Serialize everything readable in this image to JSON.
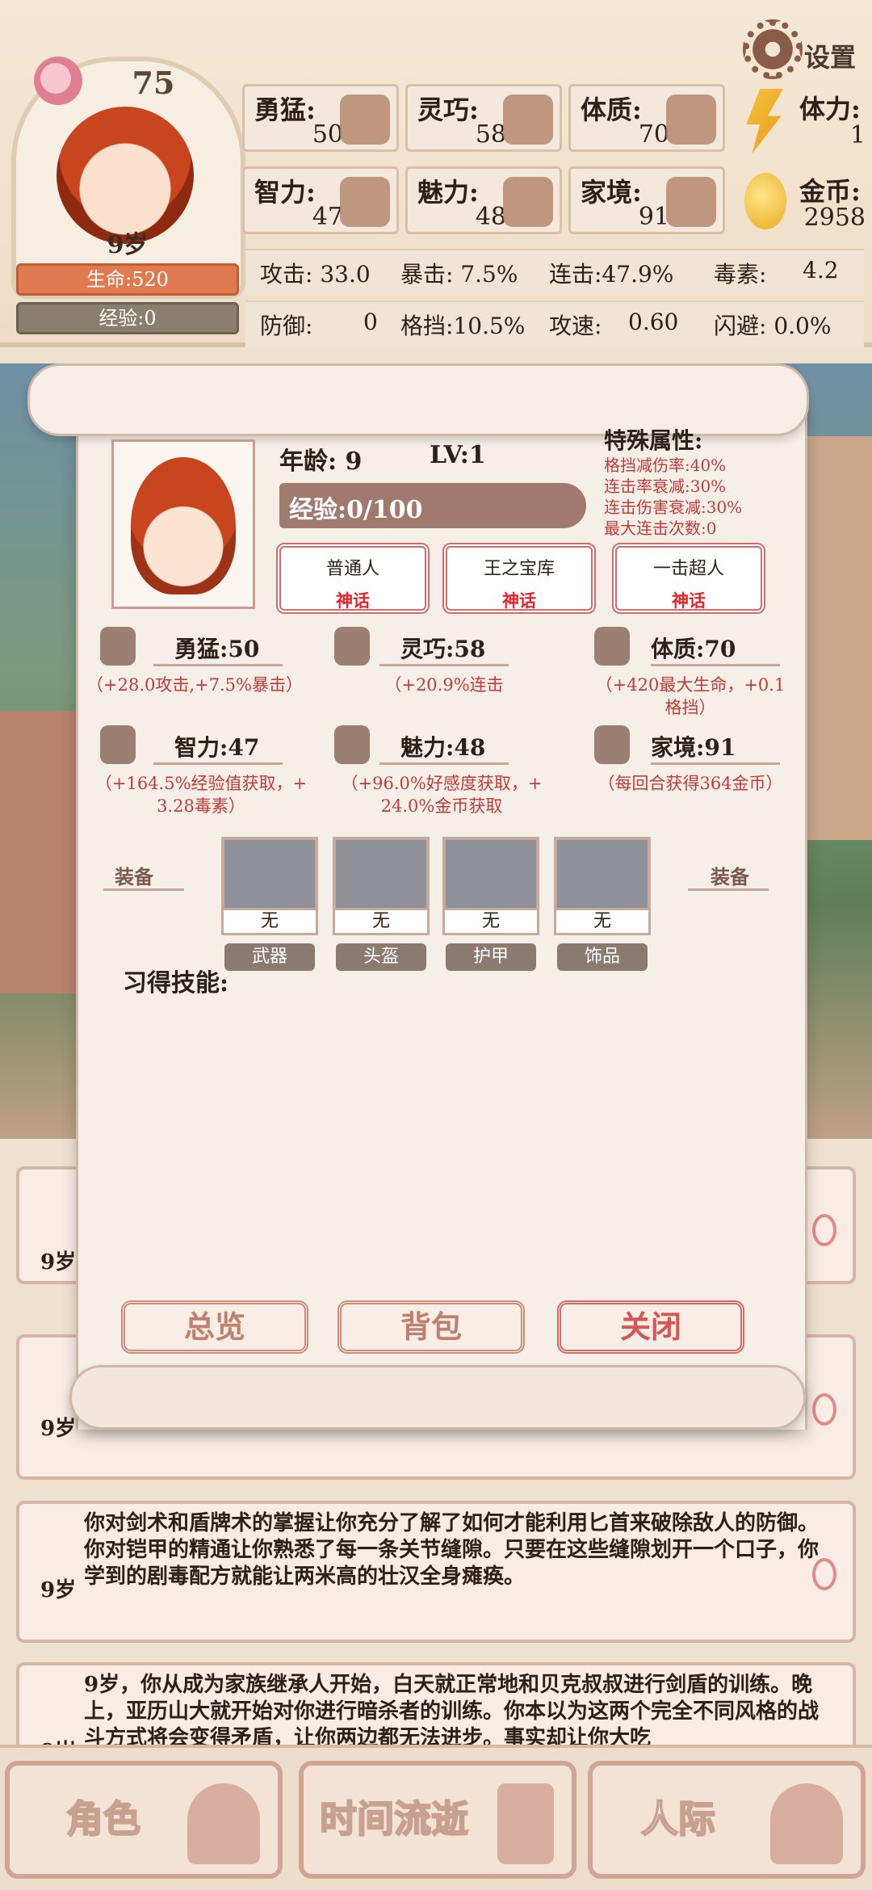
{
  "header": {
    "level": "75",
    "age_badge": "9岁",
    "hp_label": "生命:520",
    "exp_label": "经验:0",
    "settings_label": "设置",
    "stats": [
      {
        "label": "勇猛:",
        "value": "50",
        "icon": "fist-icon"
      },
      {
        "label": "灵巧:",
        "value": "58",
        "icon": "cloak-icon"
      },
      {
        "label": "体质:",
        "value": "70",
        "icon": "arm-muscle-icon"
      },
      {
        "label": "智力:",
        "value": "47",
        "icon": "brain-icon"
      },
      {
        "label": "魅力:",
        "value": "48",
        "icon": "flower-bud-icon"
      },
      {
        "label": "家境:",
        "value": "91",
        "icon": "wealth-icon"
      }
    ],
    "resources": {
      "stamina_label": "体力:",
      "stamina_value": "1",
      "gold_label": "金币:",
      "gold_value": "2958"
    },
    "combat": {
      "attack": "攻击: 33.0",
      "crit": "暴击: 7.5%",
      "combo": "连击:47.9%",
      "poison_label": "毒素:",
      "poison_value": "4.2",
      "defense_label": "防御:",
      "defense_value": "0",
      "block": "格挡:10.5%",
      "speed_label": "攻速:",
      "speed_value": "0.60",
      "dodge": "闪避: 0.0%"
    }
  },
  "panel": {
    "age_label": "年龄: 9",
    "level_label": "LV:1",
    "exp_label": "经验:0/100",
    "special_title": "特殊属性:",
    "special_items": [
      "格挡减伤率:40%",
      "连击率衰减:30%",
      "连击伤害衰减:30%",
      "最大连击次数:0"
    ],
    "traits": [
      {
        "name": "普通人",
        "rarity": "神话"
      },
      {
        "name": "王之宝库",
        "rarity": "神话"
      },
      {
        "name": "一击超人",
        "rarity": "神话"
      }
    ],
    "attributes": [
      {
        "name": "勇猛:50",
        "desc": "（+28.0攻击,+7.5%暴击）"
      },
      {
        "name": "灵巧:58",
        "desc": "（+20.9%连击"
      },
      {
        "name": "体质:70",
        "desc1": "（+420最大生命，+0.1",
        "desc2": "格挡）"
      },
      {
        "name": "智力:47",
        "desc1": "（+164.5%经验值获取，+",
        "desc2": "3.28毒素）"
      },
      {
        "name": "魅力:48",
        "desc1": "（+96.0%好感度获取，+",
        "desc2": "24.0%金币获取"
      },
      {
        "name": "家境:91",
        "desc": "（每回合获得364金币）"
      }
    ],
    "equip_side_label": "装备",
    "equipment": [
      {
        "value": "无",
        "slot": "武器"
      },
      {
        "value": "无",
        "slot": "头盔"
      },
      {
        "value": "无",
        "slot": "护甲"
      },
      {
        "value": "无",
        "slot": "饰品"
      }
    ],
    "skills_label": "习得技能:",
    "buttons": {
      "overview": "总览",
      "bag": "背包",
      "close": "关闭"
    }
  },
  "log": {
    "age_1": "9岁",
    "age_2": "9岁",
    "entry_3": {
      "age": "9岁",
      "text": "你对剑术和盾牌术的掌握让你充分了解了如何才能利用匕首来破除敌人的防御。你对铠甲的精通让你熟悉了每一条关节缝隙。只要在这些缝隙划开一个口子，你学到的剧毒配方就能让两米高的壮汉全身瘫痪。"
    },
    "entry_4": {
      "age": "9岁",
      "text": "9岁，你从成为家族继承人开始，白天就正常地和贝克叔叔进行剑盾的训练。晚上，亚历山大就开始对你进行暗杀者的训练。你本以为这两个完全不同风格的战斗方式将会变得矛盾，让你两边都无法进步。事实却让你大吃"
    }
  },
  "nav": {
    "character": "角色",
    "time": "时间流逝",
    "social": "人际"
  }
}
